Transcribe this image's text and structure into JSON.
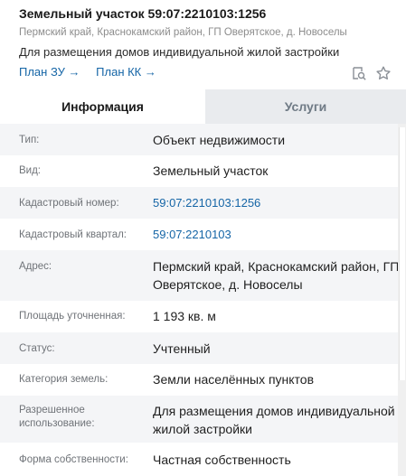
{
  "header": {
    "title": "Земельный участок 59:07:2210103:1256",
    "address": "Пермский край, Краснокамский район, ГП Оверятское, д. Новоселы",
    "purpose": "Для размещения домов индивидуальной жилой застройки",
    "links": [
      {
        "label": "План ЗУ →"
      },
      {
        "label": "План КК →"
      }
    ],
    "icons": [
      "find-on-map-icon",
      "star-icon"
    ]
  },
  "tabs": [
    {
      "label": "Информация",
      "active": true
    },
    {
      "label": "Услуги",
      "active": false
    }
  ],
  "rows": [
    {
      "label": "Тип:",
      "value": "Объект недвижимости"
    },
    {
      "label": "Вид:",
      "value": "Земельный участок"
    },
    {
      "label": "Кадастровый номер:",
      "value": "59:07:2210103:1256"
    },
    {
      "label": "Кадастровый квартал:",
      "value": "59:07:2210103"
    },
    {
      "label": "Адрес:",
      "value": "Пермский край, Краснокамский район, ГП Оверятское, д. Новоселы"
    },
    {
      "label": "Площадь уточненная:",
      "value": "1 193 кв. м"
    },
    {
      "label": "Статус:",
      "value": "Учтенный"
    },
    {
      "label": "Категория земель:",
      "value": "Земли населённых пунктов"
    },
    {
      "label": "Разрешенное использование:",
      "value": "Для размещения домов индивидуальной жилой застройки"
    },
    {
      "label": "Форма собственности:",
      "value": "Частная собственность"
    }
  ],
  "colors": {
    "link": "#1565a6",
    "label": "#6f7378",
    "row_shade": "#f4f5f7",
    "inactive_tab": "#e9ebee"
  }
}
